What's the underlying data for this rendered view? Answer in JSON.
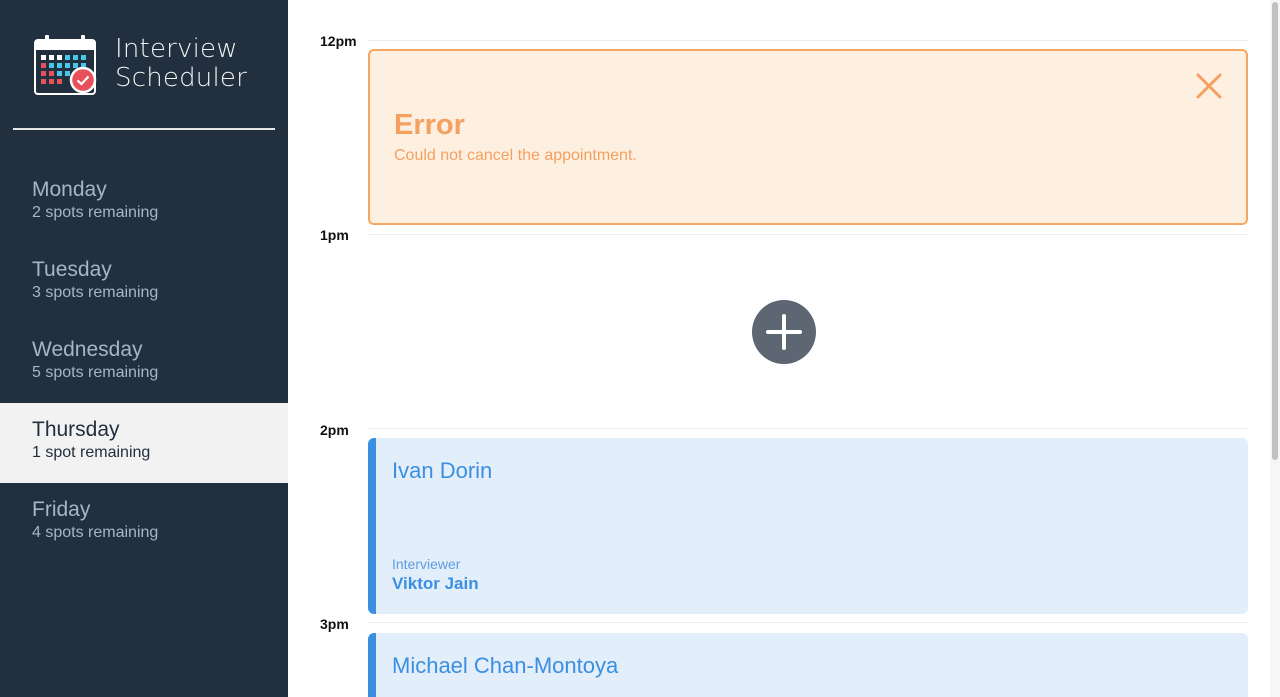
{
  "brand": {
    "title_line1": "Interview",
    "title_line2": "Scheduler",
    "logo_icon": "calendar-check-icon"
  },
  "days": [
    {
      "name": "Monday",
      "spots": "2 spots remaining",
      "selected": false
    },
    {
      "name": "Tuesday",
      "spots": "3 spots remaining",
      "selected": false
    },
    {
      "name": "Wednesday",
      "spots": "5 spots remaining",
      "selected": false
    },
    {
      "name": "Thursday",
      "spots": "1 spot remaining",
      "selected": true
    },
    {
      "name": "Friday",
      "spots": "4 spots remaining",
      "selected": false
    }
  ],
  "schedule": {
    "times": [
      "12pm",
      "1pm",
      "2pm",
      "3pm"
    ],
    "error": {
      "title": "Error",
      "message": "Could not cancel the appointment.",
      "close_icon": "close-icon"
    },
    "add_icon": "plus-icon",
    "appointments": [
      {
        "student": "Ivan Dorin",
        "interviewer_label": "Interviewer",
        "interviewer": "Viktor Jain"
      },
      {
        "student": "Michael Chan-Montoya"
      }
    ]
  },
  "colors": {
    "sidebar_bg": "#222f3e",
    "error_accent": "#f4a060",
    "error_bg": "#fef0e1",
    "appointment_accent": "#3b8fe0",
    "appointment_bg": "#e3eefb",
    "add_button_bg": "#5d6673",
    "selected_day_bg": "#f2f2f2"
  }
}
